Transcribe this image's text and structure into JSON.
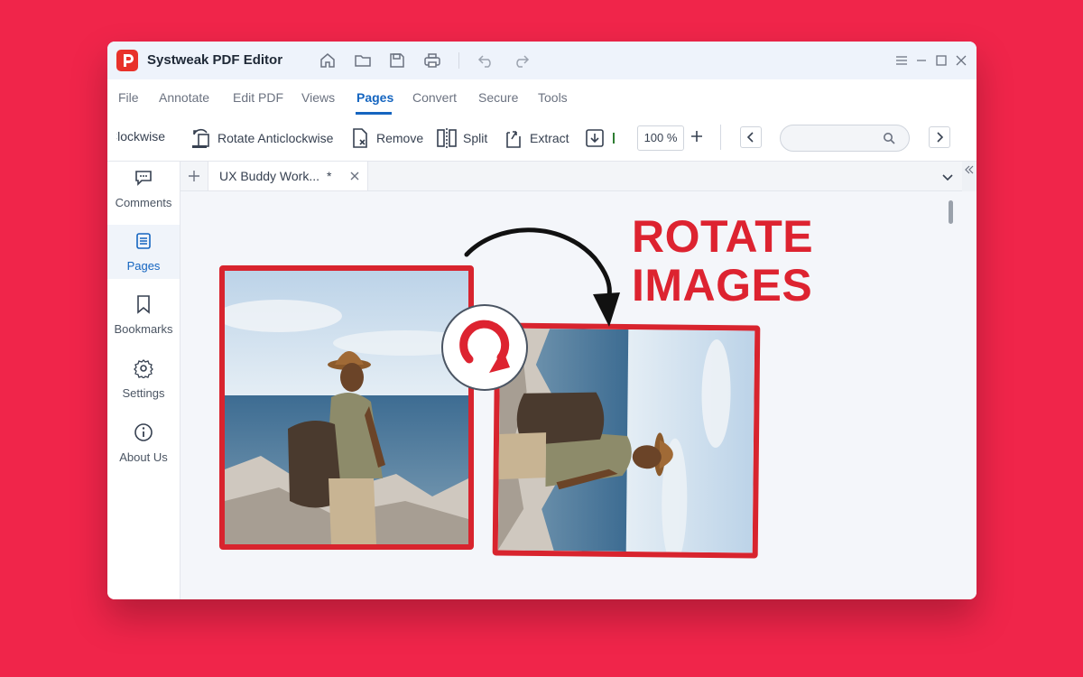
{
  "app": {
    "title": "Systweak PDF Editor"
  },
  "menu": {
    "items": [
      "File",
      "Annotate",
      "Edit PDF",
      "Views",
      "Pages",
      "Convert",
      "Secure",
      "Tools"
    ],
    "active": "Pages"
  },
  "toolbar": {
    "clockwise_label": "Clockwise",
    "anticlockwise_label": "Rotate Anticlockwise",
    "remove_label": "Remove",
    "split_label": "Split",
    "extract_label": "Extract",
    "zoom_value": "100 %"
  },
  "sidebar": {
    "items": [
      {
        "label": "Comments",
        "icon": "comments-icon"
      },
      {
        "label": "Pages",
        "icon": "pages-icon"
      },
      {
        "label": "Bookmarks",
        "icon": "bookmark-icon"
      },
      {
        "label": "Settings",
        "icon": "gear-icon"
      },
      {
        "label": "About Us",
        "icon": "info-icon"
      }
    ],
    "active": "Pages"
  },
  "doc_tab": {
    "name": "UX Buddy Work...",
    "modified_marker": "*"
  },
  "canvas": {
    "headline_line1": "ROTATE",
    "headline_line2": "IMAGES"
  },
  "colors": {
    "background": "#f0254a",
    "accent": "#1565c0",
    "brand_red": "#dd2330"
  }
}
